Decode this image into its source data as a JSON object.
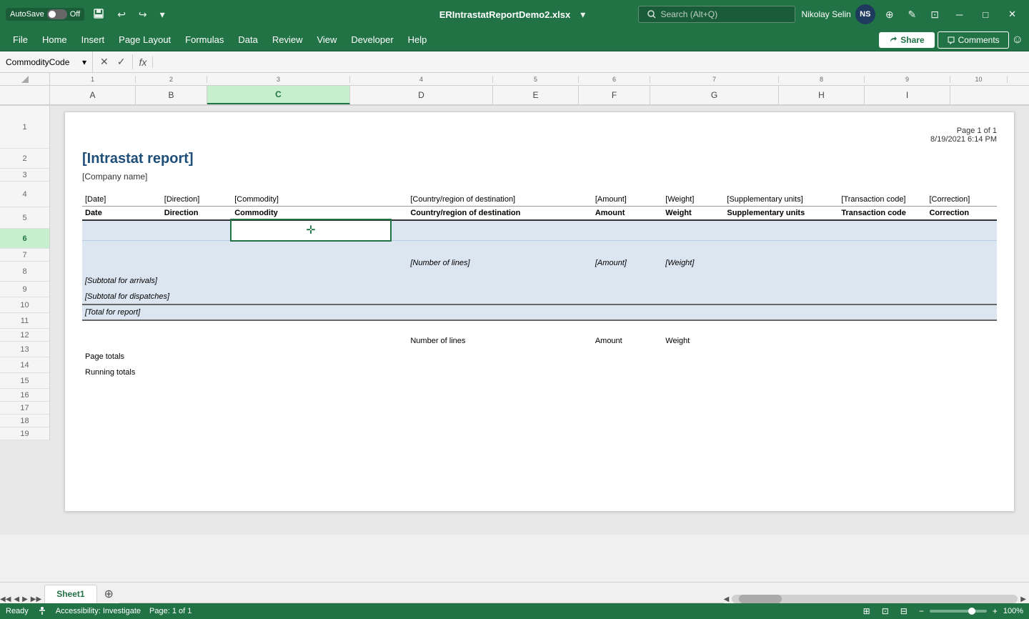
{
  "titleBar": {
    "autosave": "AutoSave",
    "autosave_state": "Off",
    "filename": "ERIntrastatReportDemo2.xlsx",
    "search_placeholder": "Search (Alt+Q)",
    "user_name": "Nikolay Selin",
    "user_initials": "NS"
  },
  "ribbonMenu": {
    "items": [
      "File",
      "Home",
      "Insert",
      "Page Layout",
      "Formulas",
      "Data",
      "Review",
      "View",
      "Developer",
      "Help"
    ],
    "share_label": "Share",
    "comments_label": "Comments"
  },
  "formulaBar": {
    "name_box": "CommodityCode",
    "cancel_label": "✕",
    "confirm_label": "✓",
    "fx_label": "fx"
  },
  "ruler": {
    "numbers": [
      "1",
      "2",
      "3",
      "4",
      "5",
      "6",
      "7",
      "8",
      "9",
      "10"
    ]
  },
  "columns": {
    "headers": [
      "A",
      "B",
      "C",
      "D",
      "E",
      "F",
      "G",
      "H",
      "I"
    ],
    "widths": [
      120,
      100,
      200,
      200,
      120,
      100,
      180,
      120,
      120
    ]
  },
  "rows": {
    "numbers": [
      "1",
      "2",
      "3",
      "4",
      "5",
      "6",
      "7",
      "8",
      "9",
      "10",
      "11",
      "12",
      "13",
      "14",
      "15",
      "16",
      "17",
      "18",
      "19"
    ],
    "active_row": "6",
    "active_col": "C"
  },
  "report": {
    "page_info_line1": "Page 1 of  1",
    "page_info_line2": "8/19/2021 6:14 PM",
    "title": "[Intrastat report]",
    "company": "[Company name]",
    "header_labels": {
      "date": "[Date]",
      "direction": "[Direction]",
      "commodity": "[Commodity]",
      "country": "[Country/region of destination]",
      "amount": "[Amount]",
      "weight": "[Weight]",
      "supp_units": "[Supplementary units]",
      "trans_code": "[Transaction code]",
      "correction": "[Correction]"
    },
    "col_labels": {
      "date": "Date",
      "direction": "Direction",
      "commodity": "Commodity",
      "country": "Country/region of destination",
      "amount": "Amount",
      "weight": "Weight",
      "supp_units": "Supplementary units",
      "trans_code": "Transaction code",
      "correction": "Correction"
    },
    "data_row_placeholders": {
      "num_lines": "[Number of lines]",
      "amount": "[Amount]",
      "weight": "[Weight]"
    },
    "subtotals": {
      "arrivals": "[Subtotal for arrivals]",
      "dispatches": "[Subtotal for dispatches]",
      "total": "[Total for report]"
    },
    "summary": {
      "num_lines": "Number of lines",
      "amount": "Amount",
      "weight": "Weight",
      "page_totals": "Page totals",
      "running_totals": "Running totals"
    }
  },
  "statusBar": {
    "ready": "Ready",
    "accessibility": "Accessibility: Investigate",
    "page_info": "Page: 1 of 1",
    "view_normal": "⊞",
    "view_page_break": "⊡",
    "view_page_layout": "⊟",
    "zoom_level": "100%"
  },
  "tabs": {
    "sheets": [
      "Sheet1"
    ],
    "active": "Sheet1"
  }
}
